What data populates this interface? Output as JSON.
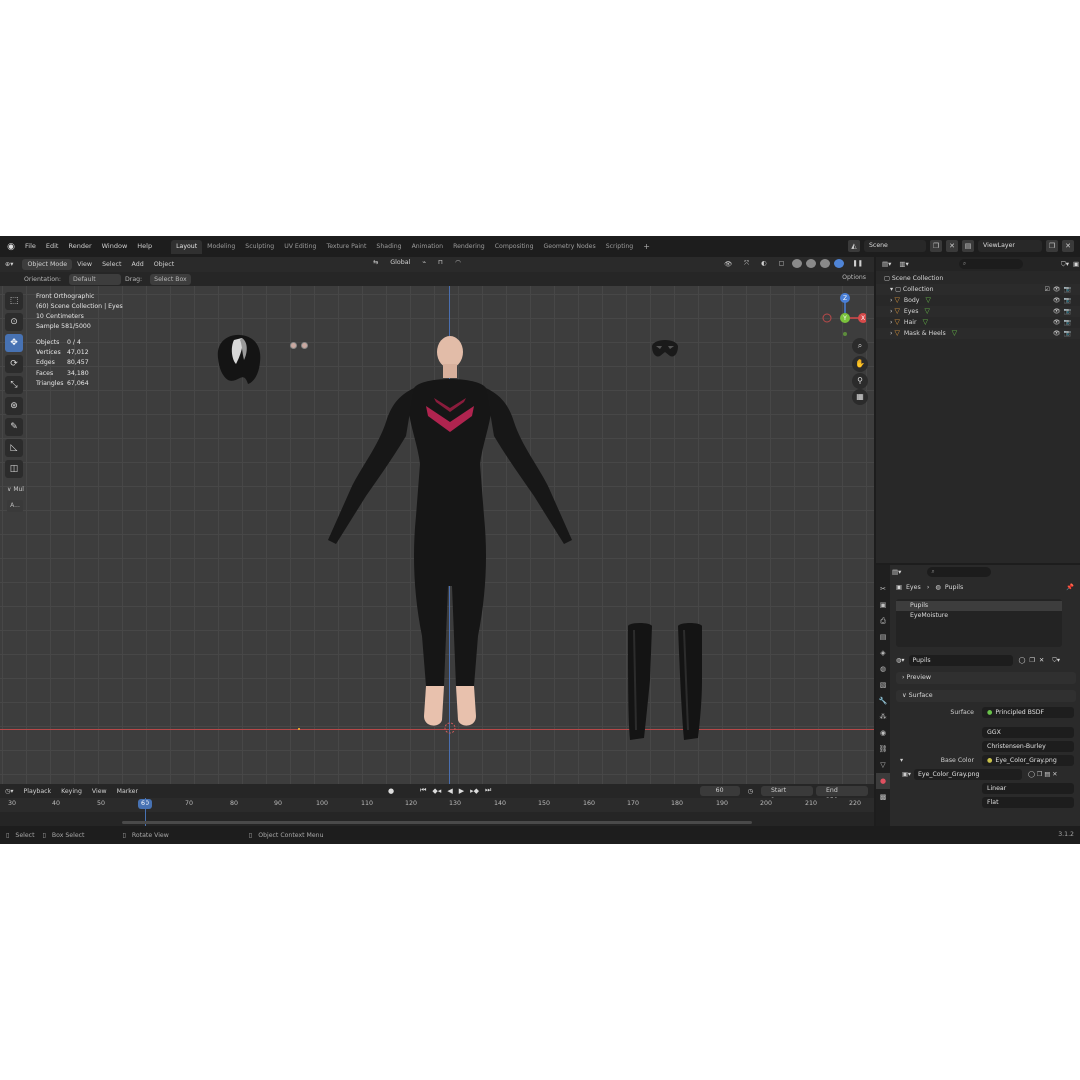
{
  "menu": [
    "File",
    "Edit",
    "Render",
    "Window",
    "Help"
  ],
  "workspaces": [
    {
      "label": "Layout",
      "active": true
    },
    {
      "label": "Modeling"
    },
    {
      "label": "Sculpting"
    },
    {
      "label": "UV Editing"
    },
    {
      "label": "Texture Paint"
    },
    {
      "label": "Shading"
    },
    {
      "label": "Animation"
    },
    {
      "label": "Rendering"
    },
    {
      "label": "Compositing"
    },
    {
      "label": "Geometry Nodes"
    },
    {
      "label": "Scripting"
    }
  ],
  "scene": {
    "name": "Scene",
    "view_layer": "ViewLayer"
  },
  "viewport_header": {
    "mode": "Object Mode",
    "menus": [
      "View",
      "Select",
      "Add",
      "Object"
    ],
    "transform_orientation": "Global"
  },
  "tool_settings": {
    "orientation_label": "Orientation:",
    "orientation_value": "Default",
    "drag_label": "Drag:",
    "drag_value": "Select Box",
    "options": "Options"
  },
  "overlay": {
    "view_name": "Front Orthographic",
    "collection": "(60) Scene Collection | Eyes",
    "scale": "10 Centimeters",
    "sample": "Sample 581/5000"
  },
  "stats": [
    {
      "label": "Objects",
      "value": "0 / 4"
    },
    {
      "label": "Vertices",
      "value": "47,012"
    },
    {
      "label": "Edges",
      "value": "80,457"
    },
    {
      "label": "Faces",
      "value": "34,180"
    },
    {
      "label": "Triangles",
      "value": "67,064"
    }
  ],
  "toolbar_extra": {
    "mul": "Mul",
    "a": "A..."
  },
  "gizmo_labels": {
    "z": "Z",
    "y": "Y",
    "x": "X"
  },
  "outliner": {
    "title": "Scene Collection",
    "collection": "Collection",
    "items": [
      "Body",
      "Eyes",
      "Hair",
      "Mask & Heels"
    ]
  },
  "properties": {
    "breadcrumb_object": "Eyes",
    "breadcrumb_material": "Pupils",
    "slots": [
      "Pupils",
      "EyeMoisture"
    ],
    "material_name": "Pupils",
    "preview_panel": "Preview",
    "surface_panel": "Surface",
    "surface_label": "Surface",
    "surface_value": "Principled BSDF",
    "distribution": "GGX",
    "subsurface": "Christensen-Burley",
    "base_color_label": "Base Color",
    "base_color_value": "Eye_Color_Gray.png",
    "image_name": "Eye_Color_Gray.png",
    "interpolation": "Linear",
    "projection": "Flat"
  },
  "timeline": {
    "menus": [
      "Playback",
      "Keying",
      "View",
      "Marker"
    ],
    "current_frame": "60",
    "start_label": "Start",
    "start": "1",
    "end_label": "End",
    "end": "250",
    "ticks": [
      "30",
      "40",
      "50",
      "70",
      "80",
      "90",
      "100",
      "110",
      "120",
      "130",
      "140",
      "150",
      "160",
      "170",
      "180",
      "190",
      "200",
      "210",
      "220"
    ]
  },
  "statusbar": {
    "select": "Select",
    "box_select": "Box Select",
    "rotate": "Rotate View",
    "context": "Object Context Menu",
    "version": "3.1.2"
  },
  "colors": {
    "accent": "#4772b3",
    "object": "#e39b3c",
    "mesh": "#69c24a",
    "x_axis": "#b74848",
    "y_axis": "#4a6fb0"
  }
}
